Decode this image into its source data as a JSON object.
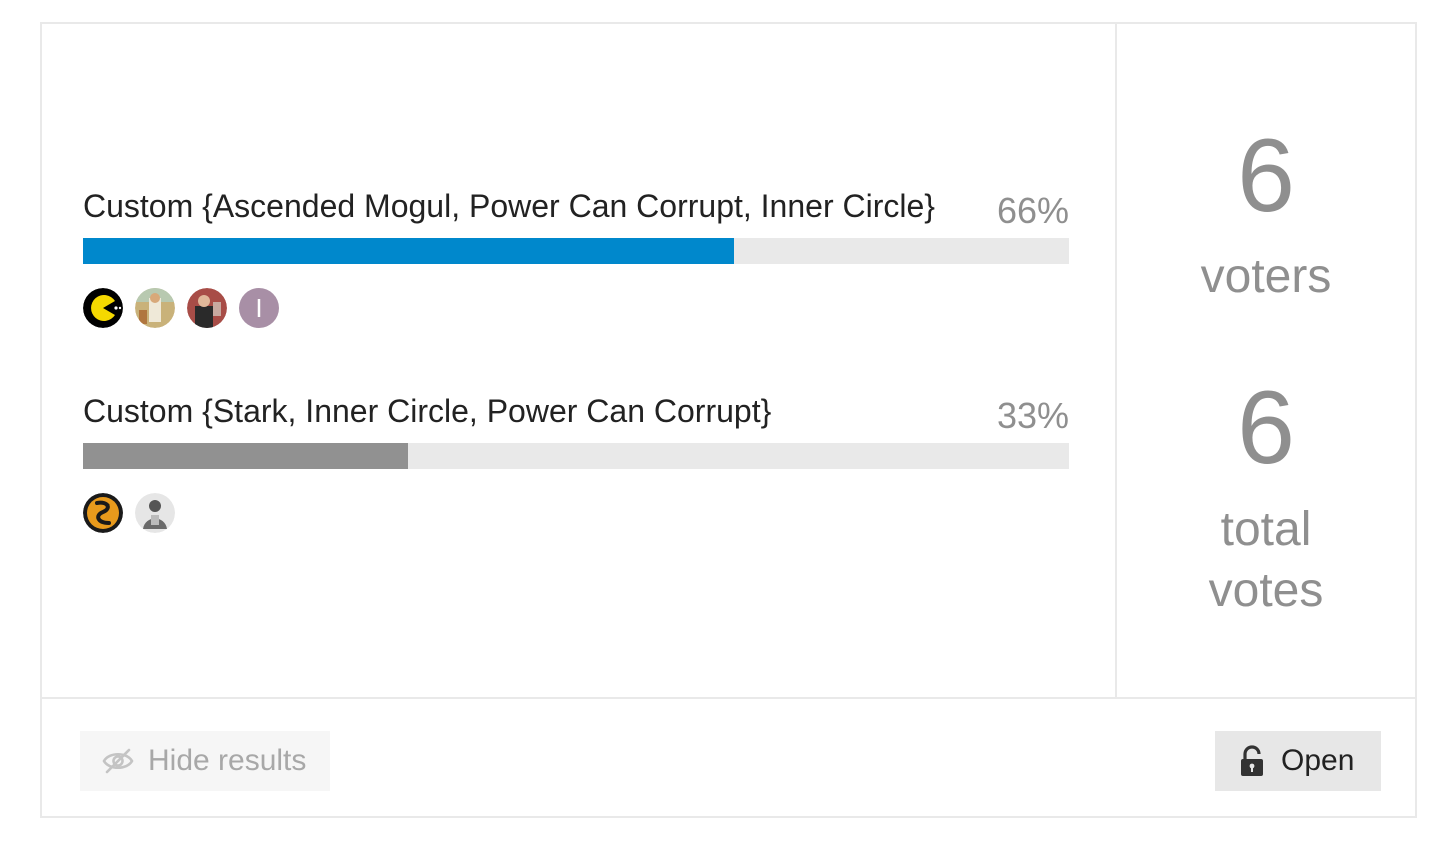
{
  "poll": {
    "options": [
      {
        "label": "Custom {Ascended Mogul, Power Can Corrupt, Inner Circle}",
        "percent_label": "66%",
        "percent": 66,
        "bar_color": "#0088cc",
        "voters": [
          {
            "type": "image",
            "icon": "pacman-avatar-icon"
          },
          {
            "type": "image",
            "icon": "photo-avatar-icon"
          },
          {
            "type": "image",
            "icon": "photo-avatar-icon"
          },
          {
            "type": "letter",
            "letter": "I",
            "color": "#a88fa6"
          }
        ]
      },
      {
        "label": "Custom {Stark, Inner Circle, Power Can Corrupt}",
        "percent_label": "33%",
        "percent": 33,
        "bar_color": "#919191",
        "voters": [
          {
            "type": "image",
            "icon": "dragon-avatar-icon"
          },
          {
            "type": "image",
            "icon": "photo-avatar-icon"
          }
        ]
      }
    ],
    "stats": {
      "voters_count": "6",
      "voters_label": "voters",
      "votes_count": "6",
      "votes_label_line1": "total",
      "votes_label_line2": "votes"
    },
    "footer": {
      "hide_results_label": "Hide results",
      "hide_results_icon": "eye-slash-icon",
      "open_label": "Open",
      "open_icon": "unlock-icon"
    },
    "colors": {
      "accent": "#0088cc",
      "muted_text": "#8f8f8f",
      "track": "#e9e9e9"
    }
  }
}
